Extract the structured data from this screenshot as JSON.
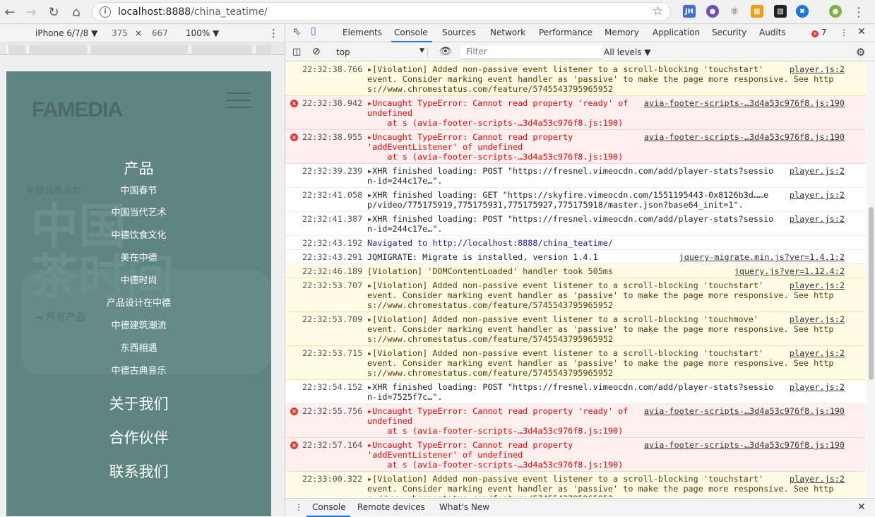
{
  "browser": {
    "url_host": "localhost:8888",
    "url_path": "/china_teatime/"
  },
  "device_toolbar": {
    "device": "iPhone 6/7/8 ▼",
    "width": "375",
    "times": "×",
    "height": "667",
    "zoom": "100% ▼"
  },
  "page": {
    "logo": "FAMEDIA",
    "ghost_tagline": "年轻且有活力",
    "ghost_title": "中国\n茶时间",
    "ghost_link": "→ 所有产品",
    "menu_products": "产品",
    "menu_items": [
      "中国春节",
      "中国当代艺术",
      "中德饮食文化",
      "美在中德",
      "中德时尚",
      "产品设计在中德",
      "中德建筑潮流",
      "东西相遇",
      "中德古典音乐"
    ],
    "menu_about": "关于我们",
    "menu_partners": "合作伙伴",
    "menu_contact": "联系我们"
  },
  "devtools": {
    "tabs": [
      "Elements",
      "Console",
      "Sources",
      "Network",
      "Performance",
      "Memory",
      "Application",
      "Security",
      "Audits"
    ],
    "active_tab": "Console",
    "error_count": "7",
    "context": "top",
    "filter_placeholder": "Filter",
    "levels": "All levels ▼",
    "drawer_tabs": [
      "Console",
      "Remote devices",
      "What's New"
    ],
    "messages": [
      {
        "type": "warn",
        "ts": "22:32:38.766",
        "lines": [
          "▸[Violation] Added non-passive event listener to a scroll-blocking 'touchstart'",
          "event. Consider marking event handler as 'passive' to make the page more responsive. See http",
          "s://www.chromestatus.com/feature/5745543795965952"
        ],
        "src": "player.js:2"
      },
      {
        "type": "err",
        "ts": "22:32:38.942",
        "lines": [
          "▸Uncaught TypeError: Cannot read property 'ready' of",
          "undefined",
          "    at s (avia-footer-scripts-…3d4a53c976f8.js:190)"
        ],
        "src": "avia-footer-scripts-…3d4a53c976f8.js:190"
      },
      {
        "type": "err",
        "ts": "22:32:38.955",
        "lines": [
          "▸Uncaught TypeError: Cannot read property",
          "'addEventListener' of undefined",
          "    at s (avia-footer-scripts-…3d4a53c976f8.js:190)"
        ],
        "src": "avia-footer-scripts-…3d4a53c976f8.js:190"
      },
      {
        "type": "info",
        "ts": "22:32:39.239",
        "lines": [
          "▸XHR finished loading: POST \"https://fresnel.vimeocdn.com/add/player-stats?sessio",
          "n-id=244c17e…\"."
        ],
        "src": "player.js:2"
      },
      {
        "type": "info",
        "ts": "22:32:41.058",
        "lines": [
          "▸XHR finished loading: GET \"https://skyfire.vimeocdn.com/1551195443-0x8126b3d……e",
          "p/video/775175919,775175931,775175927,775175918/master.json?base64_init=1\"."
        ],
        "src": "player.js:2"
      },
      {
        "type": "info",
        "ts": "22:32:41.387",
        "lines": [
          "▸XHR finished loading: POST \"https://fresnel.vimeocdn.com/add/player-stats?sessio",
          "n-id=244c17e…\"."
        ],
        "src": "player.js:2"
      },
      {
        "type": "nav",
        "ts": "22:32:43.192",
        "lines": [
          "Navigated to http://localhost:8888/china_teatime/"
        ],
        "src": ""
      },
      {
        "type": "info",
        "ts": "22:32:43.291",
        "lines": [
          "JQMIGRATE: Migrate is installed, version 1.4.1"
        ],
        "src": "jquery-migrate.min.js?ver=1.4.1:2"
      },
      {
        "type": "warn",
        "ts": "22:32:46.189",
        "lines": [
          "[Violation] 'DOMContentLoaded' handler took 505ms"
        ],
        "src": "jquery.js?ver=1.12.4:2"
      },
      {
        "type": "warn",
        "ts": "22:32:53.707",
        "lines": [
          "▸[Violation] Added non-passive event listener to a scroll-blocking 'touchstart'",
          "event. Consider marking event handler as 'passive' to make the page more responsive. See http",
          "s://www.chromestatus.com/feature/5745543795965952"
        ],
        "src": "player.js:2"
      },
      {
        "type": "warn",
        "ts": "22:32:53.709",
        "lines": [
          "▸[Violation] Added non-passive event listener to a scroll-blocking 'touchmove'",
          "event. Consider marking event handler as 'passive' to make the page more responsive. See http",
          "s://www.chromestatus.com/feature/5745543795965952"
        ],
        "src": "player.js:2"
      },
      {
        "type": "warn",
        "ts": "22:32:53.715",
        "lines": [
          "▸[Violation] Added non-passive event listener to a scroll-blocking 'touchstart'",
          "event. Consider marking event handler as 'passive' to make the page more responsive. See http",
          "s://www.chromestatus.com/feature/5745543795965952"
        ],
        "src": "player.js:2"
      },
      {
        "type": "info",
        "ts": "22:32:54.152",
        "lines": [
          "▸XHR finished loading: POST \"https://fresnel.vimeocdn.com/add/player-stats?sessio",
          "n-id=7525f7c…\"."
        ],
        "src": "player.js:2"
      },
      {
        "type": "err",
        "ts": "22:32:55.756",
        "lines": [
          "▸Uncaught TypeError: Cannot read property 'ready' of",
          "undefined",
          "    at s (avia-footer-scripts-…3d4a53c976f8.js:190)"
        ],
        "src": "avia-footer-scripts-…3d4a53c976f8.js:190"
      },
      {
        "type": "err",
        "ts": "22:32:57.164",
        "lines": [
          "▸Uncaught TypeError: Cannot read property",
          "'addEventListener' of undefined",
          "    at s (avia-footer-scripts-…3d4a53c976f8.js:190)"
        ],
        "src": "avia-footer-scripts-…3d4a53c976f8.js:190"
      },
      {
        "type": "warn",
        "ts": "22:33:00.322",
        "lines": [
          "▸[Violation] Added non-passive event listener to a scroll-blocking 'touchstart'",
          "event. Consider marking event handler as 'passive' to make the page more responsive. See http",
          "s://www.chromestatus.com/feature/5745543795965952"
        ],
        "src": "player.js:2"
      }
    ]
  }
}
